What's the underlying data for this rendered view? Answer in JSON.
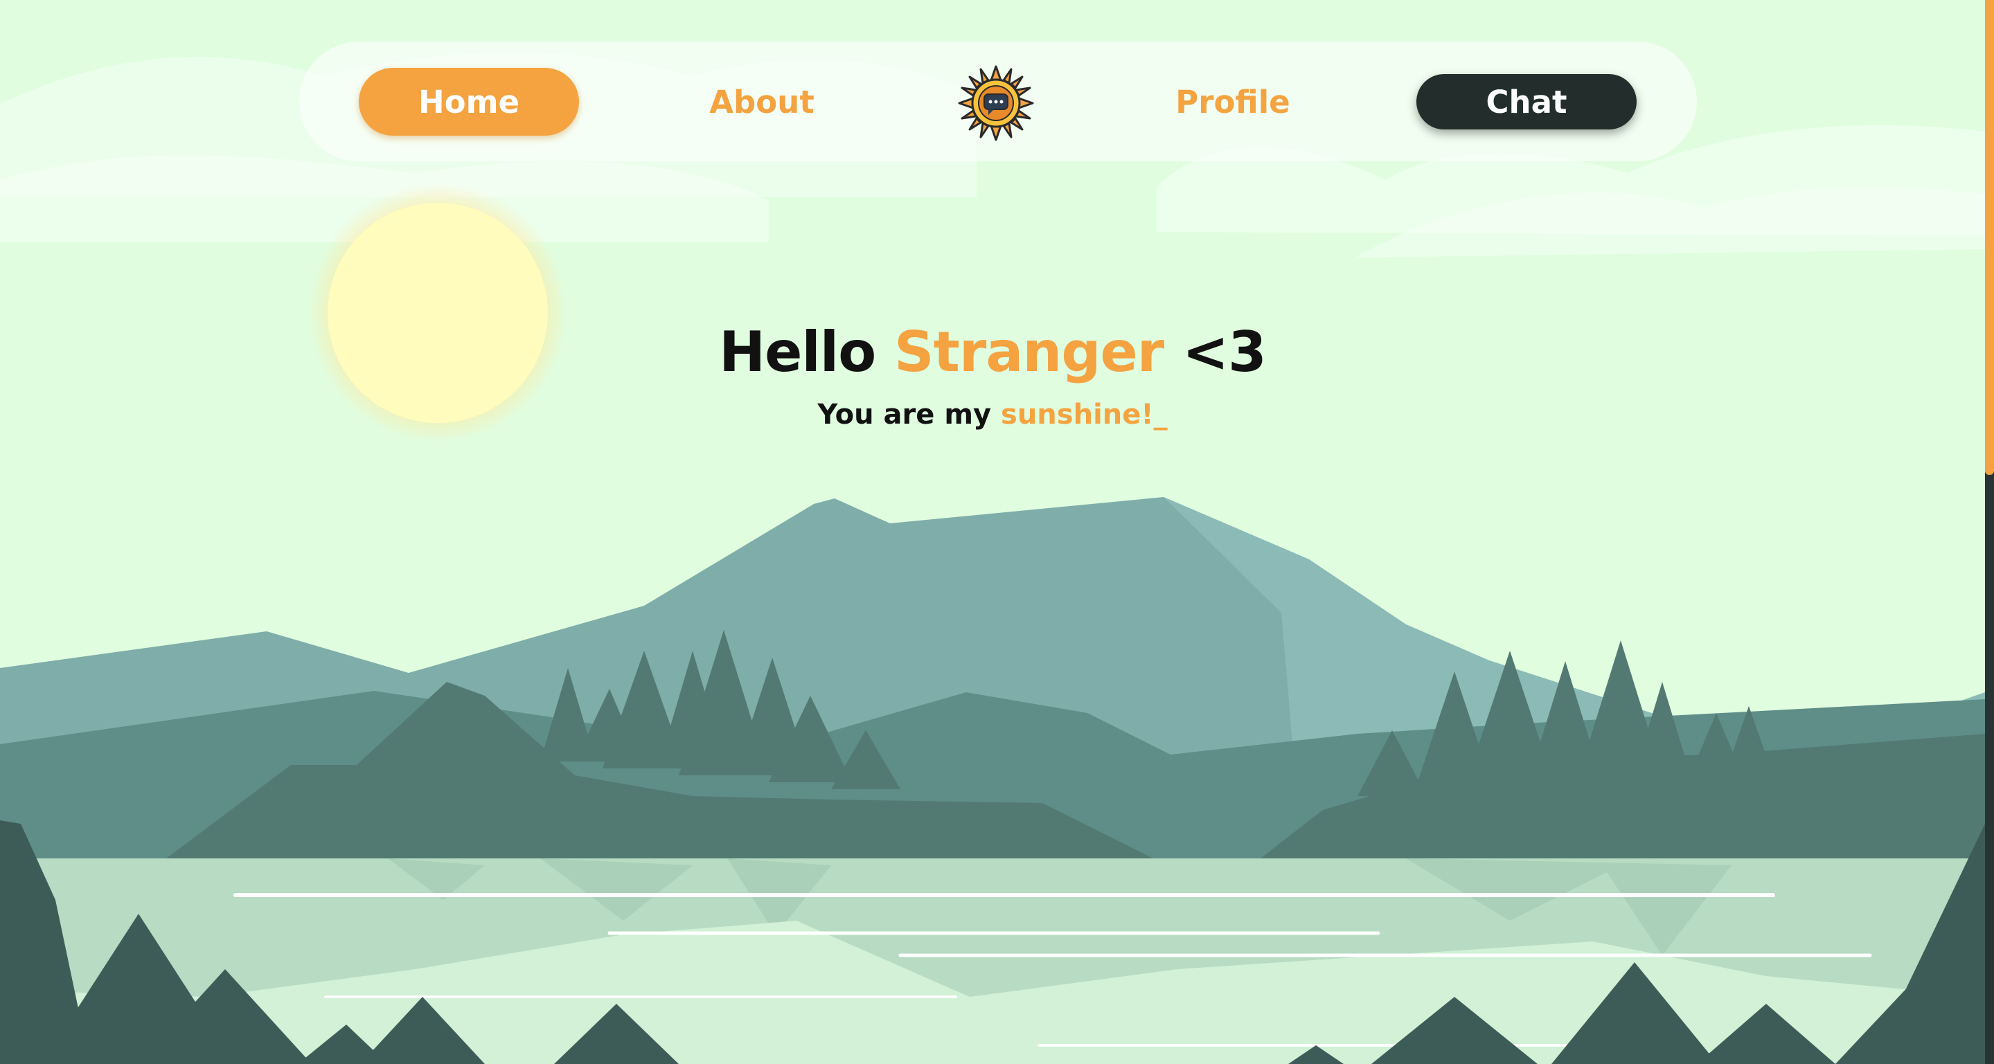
{
  "nav": {
    "home_label": "Home",
    "about_label": "About",
    "profile_label": "Profile",
    "chat_label": "Chat"
  },
  "hero": {
    "greeting": "Hello",
    "name": "Stranger",
    "heart": "<3",
    "sub_prefix": "You are my",
    "sub_accent": "sunshine!",
    "cursor": "_"
  },
  "colors": {
    "background": "#e0fde0",
    "accent": "#f4a340",
    "dark": "#222d2c",
    "sun": "#fffcbd",
    "lake": "#b7dbc3"
  },
  "icons": {
    "logo": "sunflower-chat-icon"
  }
}
